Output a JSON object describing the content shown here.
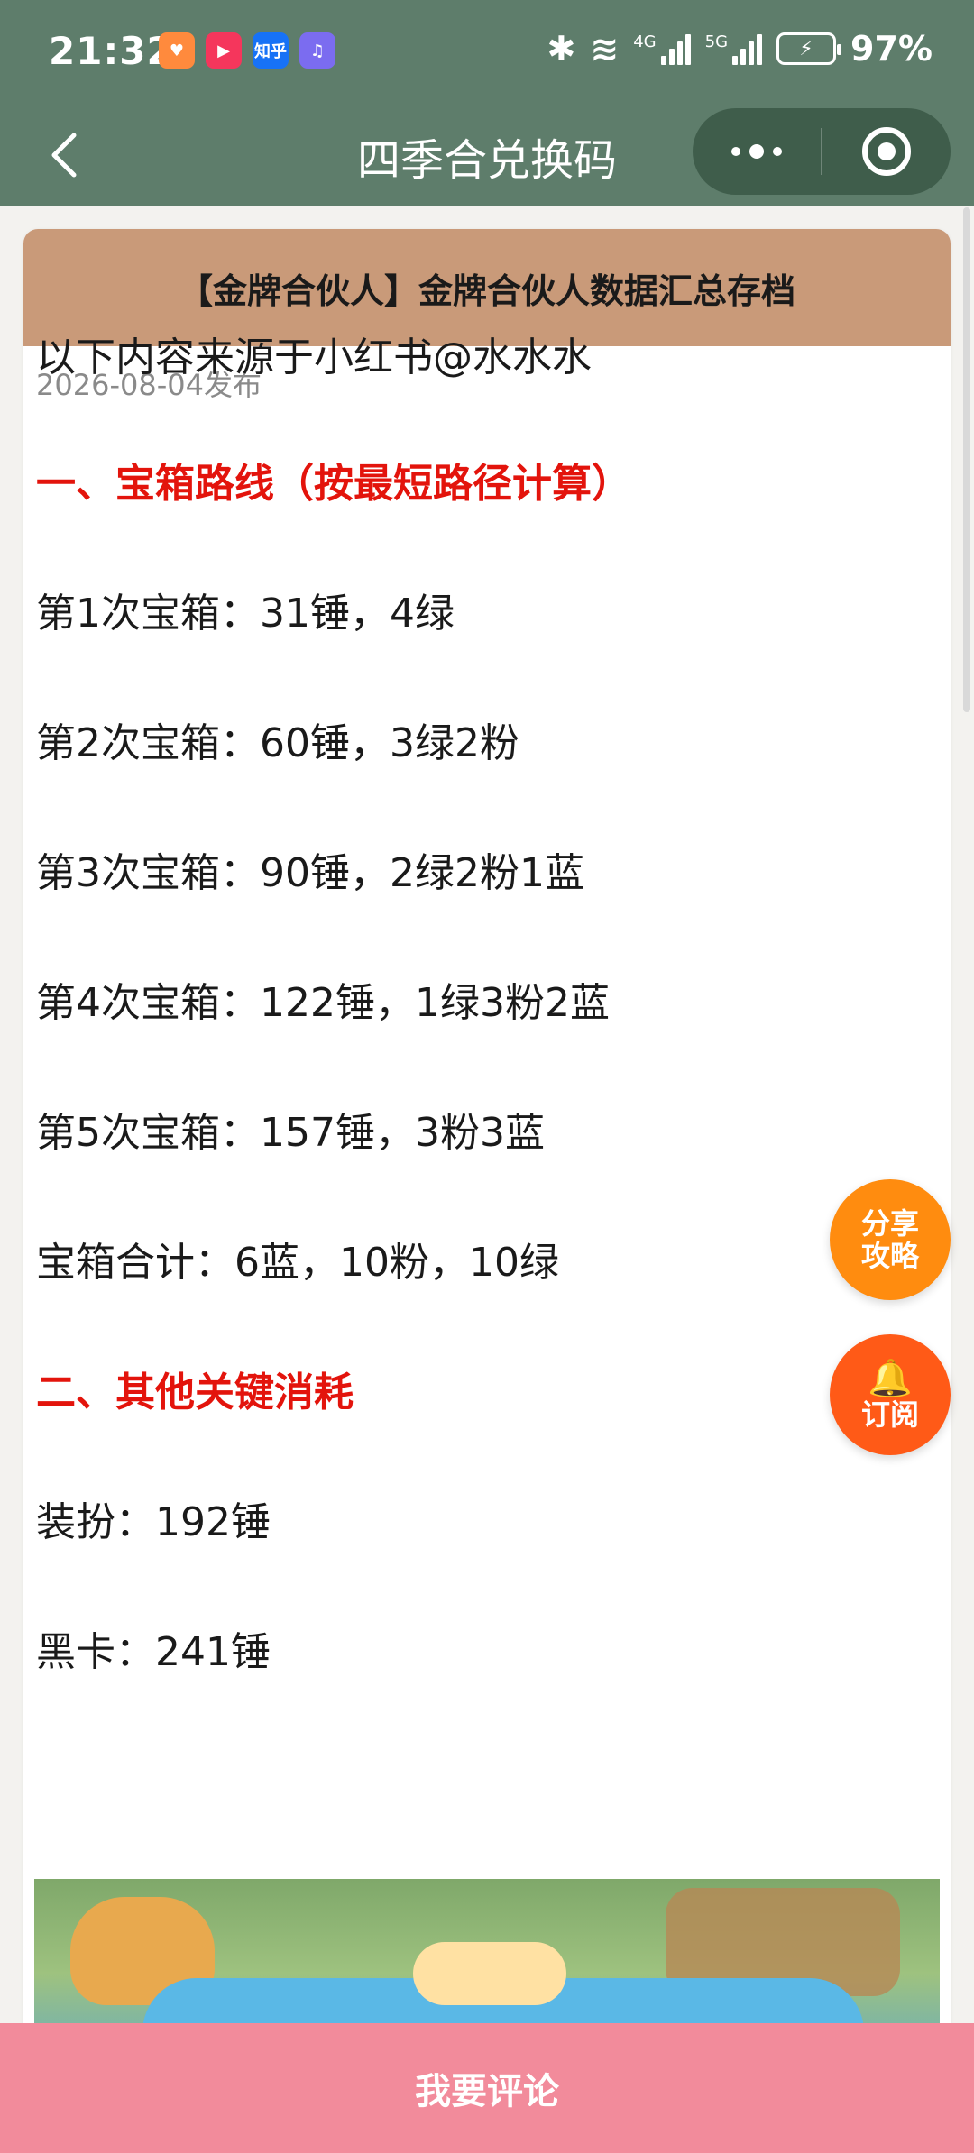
{
  "status_bar": {
    "time": "21:32",
    "apps": [
      {
        "name": "app-heart-icon",
        "label": "♥",
        "color": "#ff8a3d"
      },
      {
        "name": "app-play-icon",
        "label": "▶",
        "color": "#f5365c"
      },
      {
        "name": "zhihu-icon",
        "label": "知乎",
        "color": "#1772f6"
      },
      {
        "name": "music-icon",
        "label": "♫",
        "color": "#7b6cf0"
      }
    ],
    "network_4g": "4G",
    "network_5g": "5G",
    "battery": "97%"
  },
  "nav": {
    "title": "四季合兑换码"
  },
  "article": {
    "header": "【金牌合伙人】金牌合伙人数据汇总存档",
    "date": "2026-08-04发布",
    "lines": [
      {
        "text": "以下内容来源于小红书@水水水",
        "style": "normal"
      },
      {
        "text": "一、宝箱路线（按最短路径计算）",
        "style": "red"
      },
      {
        "text": "第1次宝箱：31锤，4绿",
        "style": "normal"
      },
      {
        "text": "第2次宝箱：60锤，3绿2粉",
        "style": "normal"
      },
      {
        "text": "第3次宝箱：90锤，2绿2粉1蓝",
        "style": "normal"
      },
      {
        "text": "第4次宝箱：122锤，1绿3粉2蓝",
        "style": "normal"
      },
      {
        "text": "第5次宝箱：157锤，3粉3蓝",
        "style": "normal"
      },
      {
        "text": "宝箱合计：6蓝，10粉，10绿",
        "style": "normal"
      },
      {
        "text": "二、其他关键消耗",
        "style": "red"
      },
      {
        "text": "装扮：192锤",
        "style": "normal"
      },
      {
        "text": "黑卡：241锤",
        "style": "normal"
      }
    ]
  },
  "fab": {
    "share_line1": "分享",
    "share_line2": "攻略",
    "subscribe": "订阅"
  },
  "bottom": {
    "comment": "我要评论"
  }
}
